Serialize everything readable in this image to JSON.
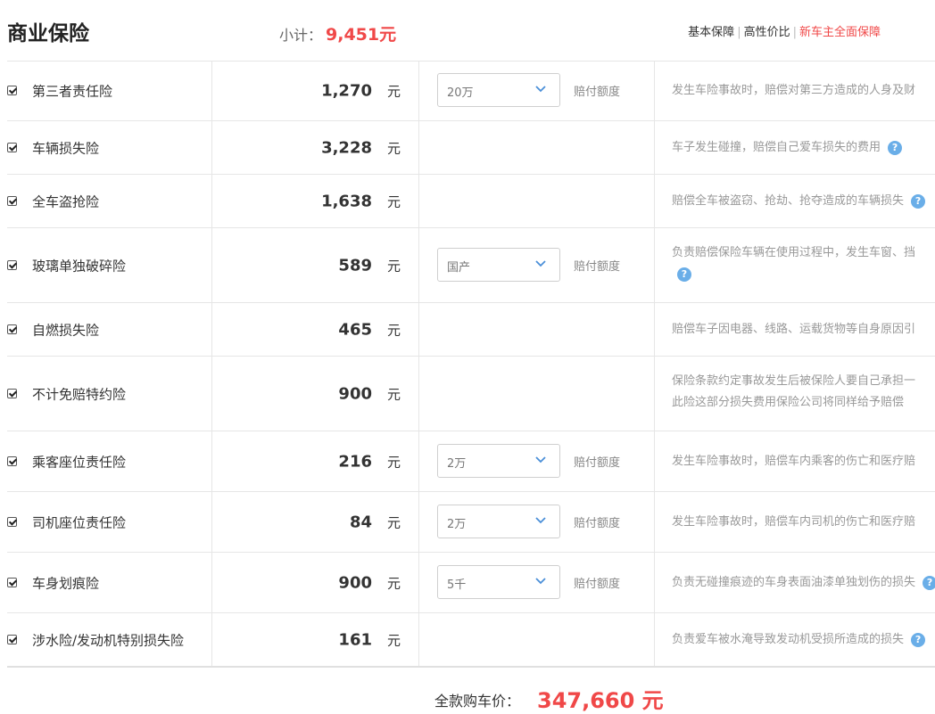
{
  "header": {
    "title": "商业保险",
    "subtotal_label": "小计：",
    "subtotal_value": "9,451元",
    "links": [
      "基本保障",
      "高性价比",
      "新车主全面保障"
    ]
  },
  "rows": [
    {
      "name": "第三者责任险",
      "price": "1,270",
      "unit": "元",
      "option": "20万",
      "option_label": "赔付额度",
      "desc": [
        "发生车险事故时，赔偿对第三方造成的人身及财"
      ],
      "help": false
    },
    {
      "name": "车辆损失险",
      "price": "3,228",
      "unit": "元",
      "option": null,
      "option_label": null,
      "desc": [
        "车子发生碰撞，赔偿自己爱车损失的费用"
      ],
      "help": true
    },
    {
      "name": "全车盗抢险",
      "price": "1,638",
      "unit": "元",
      "option": null,
      "option_label": null,
      "desc": [
        "赔偿全车被盗窃、抢劫、抢夺造成的车辆损失"
      ],
      "help": true
    },
    {
      "name": "玻璃单独破碎险",
      "price": "589",
      "unit": "元",
      "option": "国产",
      "option_label": "赔付额度",
      "desc": [
        "负责赔偿保险车辆在使用过程中，发生车窗、挡"
      ],
      "help": true
    },
    {
      "name": "自燃损失险",
      "price": "465",
      "unit": "元",
      "option": null,
      "option_label": null,
      "desc": [
        "赔偿车子因电器、线路、运载货物等自身原因引"
      ],
      "help": false
    },
    {
      "name": "不计免赔特约险",
      "price": "900",
      "unit": "元",
      "option": null,
      "option_label": null,
      "desc": [
        "保险条款约定事故发生后被保险人要自己承担一",
        "此险这部分损失费用保险公司将同样给予赔偿"
      ],
      "help": false
    },
    {
      "name": "乘客座位责任险",
      "price": "216",
      "unit": "元",
      "option": "2万",
      "option_label": "赔付额度",
      "desc": [
        "发生车险事故时，赔偿车内乘客的伤亡和医疗赔"
      ],
      "help": false
    },
    {
      "name": "司机座位责任险",
      "price": "84",
      "unit": "元",
      "option": "2万",
      "option_label": "赔付额度",
      "desc": [
        "发生车险事故时，赔偿车内司机的伤亡和医疗赔"
      ],
      "help": false
    },
    {
      "name": "车身划痕险",
      "price": "900",
      "unit": "元",
      "option": "5千",
      "option_label": "赔付额度",
      "desc": [
        "负责无碰撞痕迹的车身表面油漆单独划伤的损失"
      ],
      "help": true
    },
    {
      "name": "涉水险/发动机特别损失险",
      "price": "161",
      "unit": "元",
      "option": null,
      "option_label": null,
      "desc": [
        "负责爱车被水淹导致发动机受损所造成的损失"
      ],
      "help": true
    }
  ],
  "footer": {
    "total_label": "全款购车价：",
    "total_value": "347,660 元"
  },
  "colors": {
    "accent": "#f04848",
    "help": "#6aaee8"
  }
}
